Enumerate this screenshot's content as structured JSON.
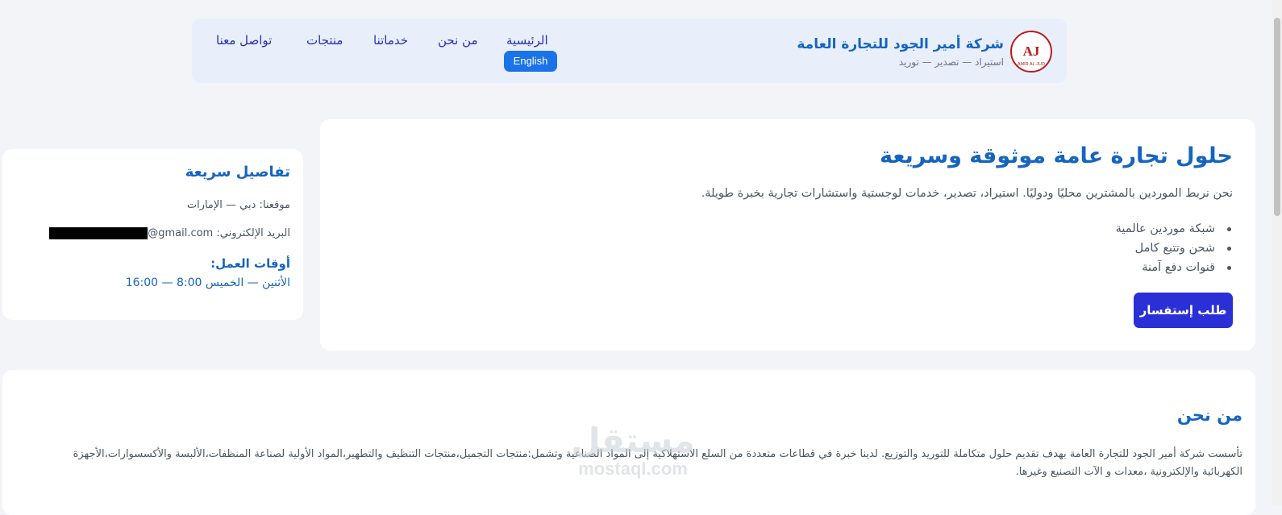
{
  "header": {
    "brand_name": "شركة أمير الجود للتجارة العامة",
    "brand_tagline": "استيراد — تصدير — توريد",
    "logo_text": "AJ",
    "logo_subtext": "AMIR AL-JUD",
    "nav": {
      "home": "الرئيسية",
      "about": "من نحن",
      "services": "خدماتنا",
      "products": "منتجات",
      "contact": "تواصل معنا"
    },
    "lang_button": "English"
  },
  "hero": {
    "title": "حلول تجارة عامة موثوقة وسريعة",
    "description": "نحن نربط الموردين بالمشترين محليًا ودوليًا. استيراد، تصدير، خدمات لوجستية واستشارات تجارية بخبرة طويلة.",
    "features": [
      "شبكة موردين عالمية",
      "شحن وتتبع كامل",
      "قنوات دفع آمنة"
    ],
    "cta": "طلب إستفسار"
  },
  "quick": {
    "title": "تفاصيل سريعة",
    "location": "موقعنا: دبي — الإمارات",
    "email_label": "البريد الإلكتروني:",
    "email_domain": "@gmail.com",
    "hours_title": "أوقات العمل:",
    "hours": "الأثنين — الخميس 8:00 — 16:00"
  },
  "about": {
    "title": "من نحن",
    "text": "تأسست شركة أمير الجود للتجارة العامة بهدف تقديم حلول متكاملة للتوريد والتوزيع. لدينا خبرة في قطاعات متعددة من السلع الاستهلاكية إلى المواد الصناعية وتشمل:منتجات التجميل،منتجات التنظيف والتطهير،المواد الأولية لصناعة المنظفات،الألبسة والأكسسوارات،الأجهزة الكهربائية والإلكترونية ،معدات و الآت التصنيع وغيرها."
  },
  "watermark": {
    "arabic": "مستقل",
    "latin": "mostaql.com"
  }
}
